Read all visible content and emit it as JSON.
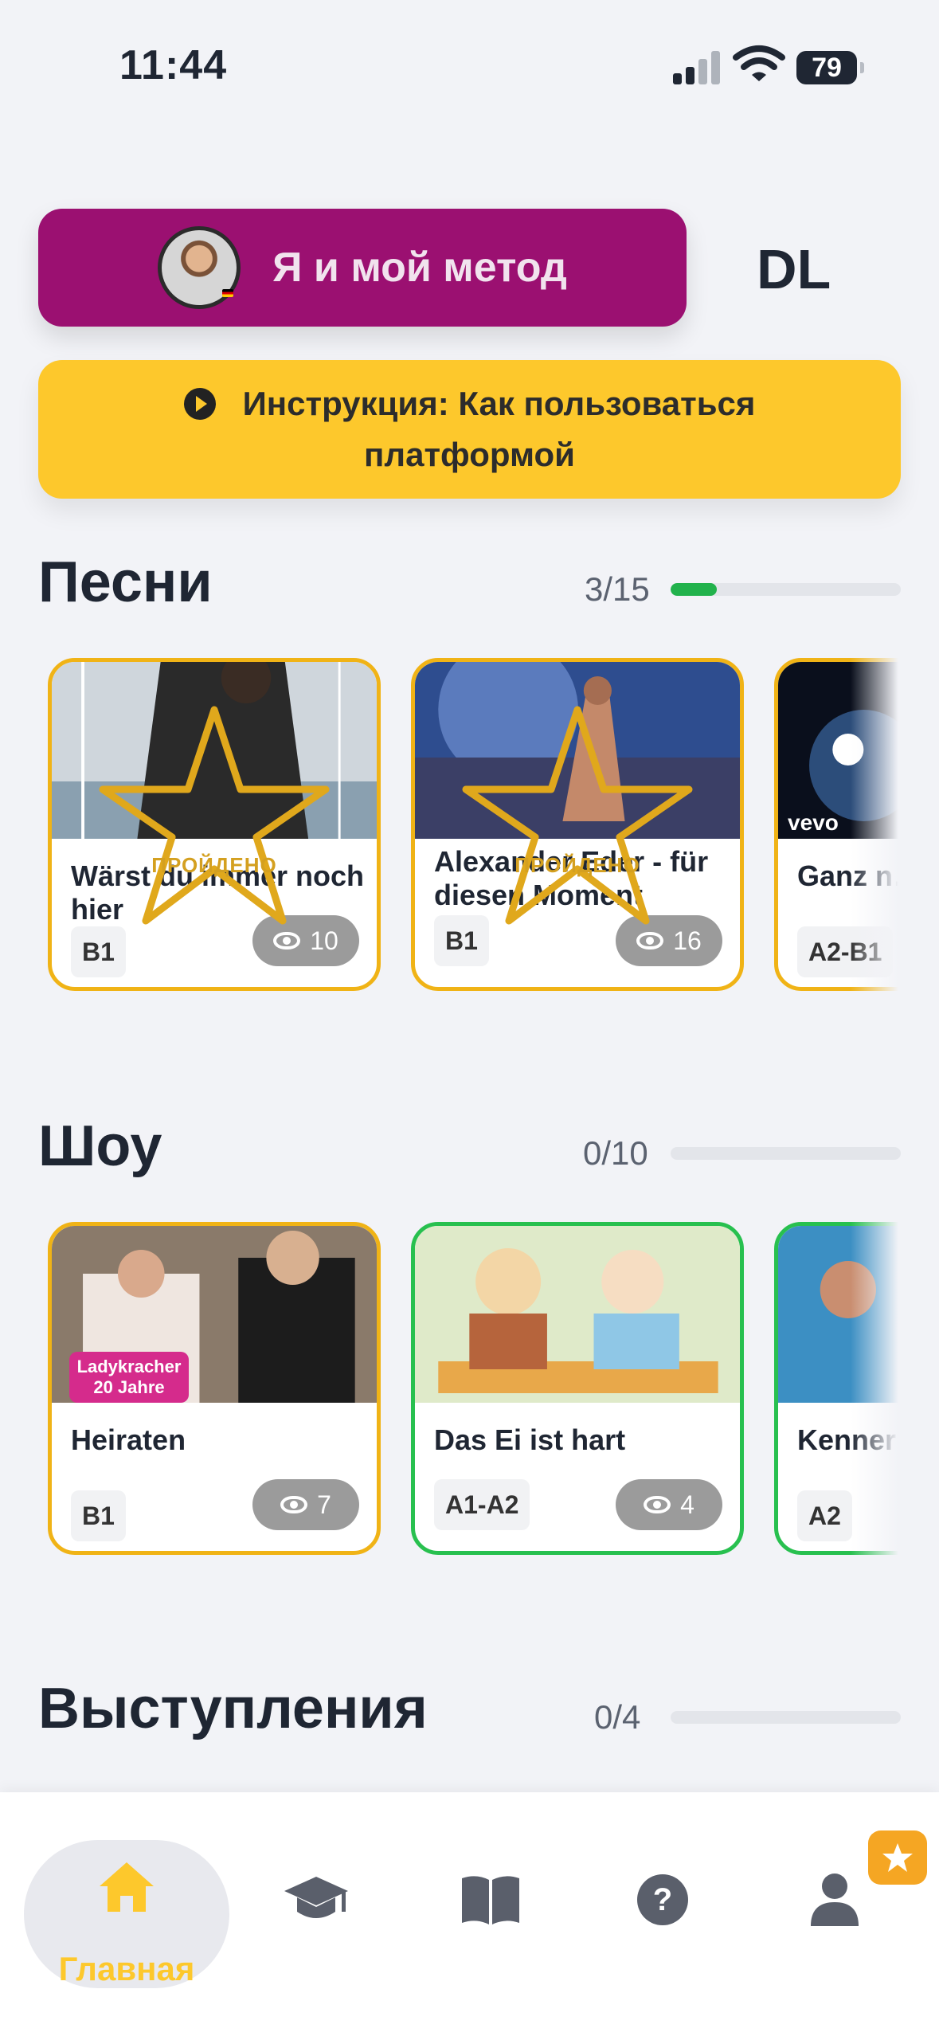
{
  "status": {
    "time": "11:44",
    "battery": "79"
  },
  "header": {
    "method_label": "Я и мой метод",
    "dl_label": "DL"
  },
  "instruction": {
    "label": "Инструкция: Как пользоваться платформой"
  },
  "sections": [
    {
      "title": "Песни",
      "progress_text": "3/15",
      "progress": 0.2,
      "cards": [
        {
          "title": "Wärst du immer noch hier",
          "level": "B1",
          "views": "10",
          "passed_label": "ПРОЙДЕНО",
          "border": "#f0b316"
        },
        {
          "title": "Alexander Eder - für diesen Moment",
          "level": "B1",
          "views": "16",
          "passed_label": "ПРОЙДЕНО",
          "border": "#f0b316"
        },
        {
          "title": "Ganz n… gestört…",
          "level": "A2-B1",
          "thumb_label": "vevo",
          "border": "#f0b316"
        }
      ]
    },
    {
      "title": "Шоу",
      "progress_text": "0/10",
      "progress": 0,
      "cards": [
        {
          "title": "Heiraten",
          "level": "B1",
          "views": "7",
          "thumb_label": "Ladykracher 20 Jahre",
          "border": "#f0b316"
        },
        {
          "title": "Das Ei ist hart",
          "level": "A1-A2",
          "views": "4",
          "border": "#28c04f"
        },
        {
          "title": "Kenner… Pool",
          "level": "A2",
          "border": "#28c04f"
        }
      ]
    },
    {
      "title": "Выступления",
      "progress_text": "0/4",
      "progress": 0
    }
  ],
  "nav": {
    "home_label": "Главная",
    "items": [
      "home-icon",
      "graduation-cap-icon",
      "book-icon",
      "help-icon",
      "profile-icon"
    ]
  },
  "colors": {
    "accent_purple": "#9b1071",
    "accent_yellow": "#fdc82c",
    "progress_green": "#22b24c"
  }
}
